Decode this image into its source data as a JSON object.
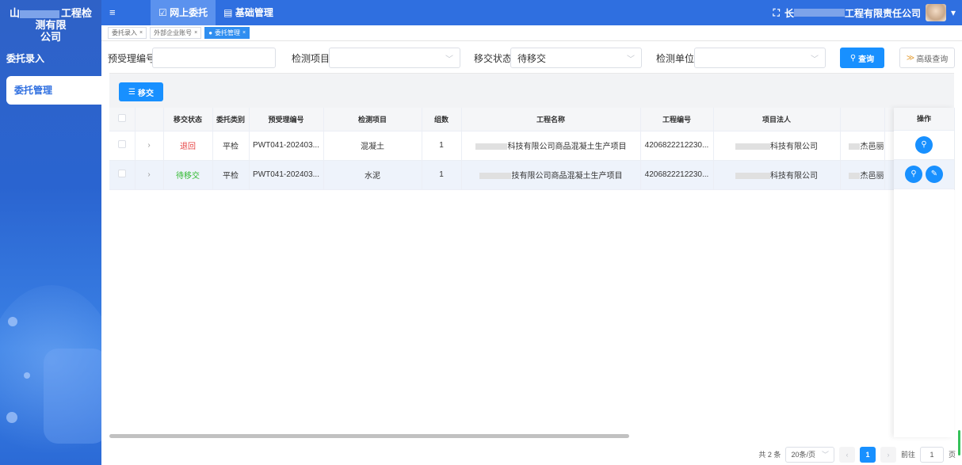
{
  "app": {
    "title_suffix": "工程检测有限",
    "title_line2": "公司",
    "title_prefix": "山"
  },
  "sidebar": {
    "items": [
      {
        "label": "委托录入"
      },
      {
        "label": "委托管理"
      }
    ]
  },
  "topbar": {
    "menu_icon": "≡",
    "nav": [
      {
        "label": "网上委托",
        "icon": "☑"
      },
      {
        "label": "基础管理",
        "icon": "▤"
      }
    ],
    "company_suffix": "工程有限责任公司",
    "company_prefix": "长",
    "fullscreen_icon": "⛶"
  },
  "tabs": [
    {
      "label": "委托录入"
    },
    {
      "label": "外部企业账号"
    },
    {
      "label": "委托管理"
    }
  ],
  "search": {
    "preacceptance_label": "预受理编号",
    "preacceptance_value": "",
    "item_label": "检测项目",
    "item_value": "",
    "status_label": "移交状态",
    "status_value": "待移交",
    "unit_label": "检测单位",
    "unit_value": "",
    "query_label": "查询",
    "advanced_label": "高级查询"
  },
  "toolbar": {
    "transfer_label": "移交"
  },
  "table": {
    "columns": [
      "移交状态",
      "委托类别",
      "预受理编号",
      "检测项目",
      "组数",
      "工程名称",
      "工程编号",
      "项目法人",
      "操作"
    ],
    "rows": [
      {
        "status": "退回",
        "category": "平检",
        "pre_no": "PWT041-202403...",
        "item": "混凝土",
        "groups": "1",
        "project": "科技有限公司商品混凝土生产项目",
        "project_no": "4206822212230...",
        "owner": "科技有限公司",
        "extra": "杰邑丽"
      },
      {
        "status": "待移交",
        "category": "平检",
        "pre_no": "PWT041-202403...",
        "item": "水泥",
        "groups": "1",
        "project": "技有限公司商品混凝土生产项目",
        "project_no": "4206822212230...",
        "owner": "科技有限公司",
        "extra": "杰邑丽"
      }
    ]
  },
  "pager": {
    "total": "共 2 条",
    "page_size": "20条/页",
    "current_page": "1",
    "goto_label": "前往",
    "goto_value": "1",
    "page_unit": "页"
  },
  "colors": {
    "primary": "#1890ff",
    "sidebar": "#2f6fe0",
    "status_returned": "#e64545",
    "status_pending": "#2eb82e"
  }
}
